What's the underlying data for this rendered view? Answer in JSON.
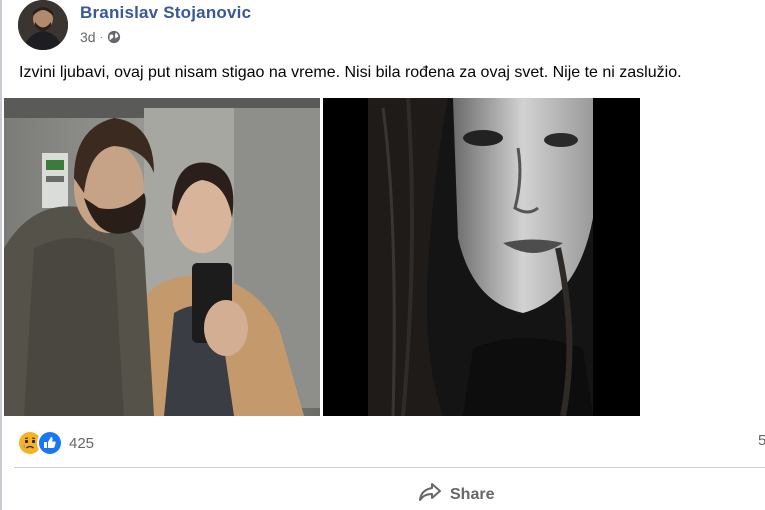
{
  "post": {
    "author": "Branislav Stojanovic",
    "time": "3d",
    "separator": "·",
    "privacy_icon": "globe-icon",
    "text": "Izvini ljubavi, ovaj put nisam stigao na vreme. Nisi bila rođena za ovaj svet. Nije te ni zaslužio.",
    "photos": [
      "selfie-couple-photo",
      "woman-portrait-photo"
    ]
  },
  "reactions": {
    "icons": [
      "sad-reaction-icon",
      "like-reaction-icon"
    ],
    "count": "425",
    "side_count": "5"
  },
  "actions": {
    "share_label": "Share",
    "share_icon": "share-arrow-icon"
  },
  "colors": {
    "author_link": "#385898",
    "secondary_text": "#65676b",
    "like_blue": "#1877f2",
    "sad_yellow": "#f7b125"
  }
}
